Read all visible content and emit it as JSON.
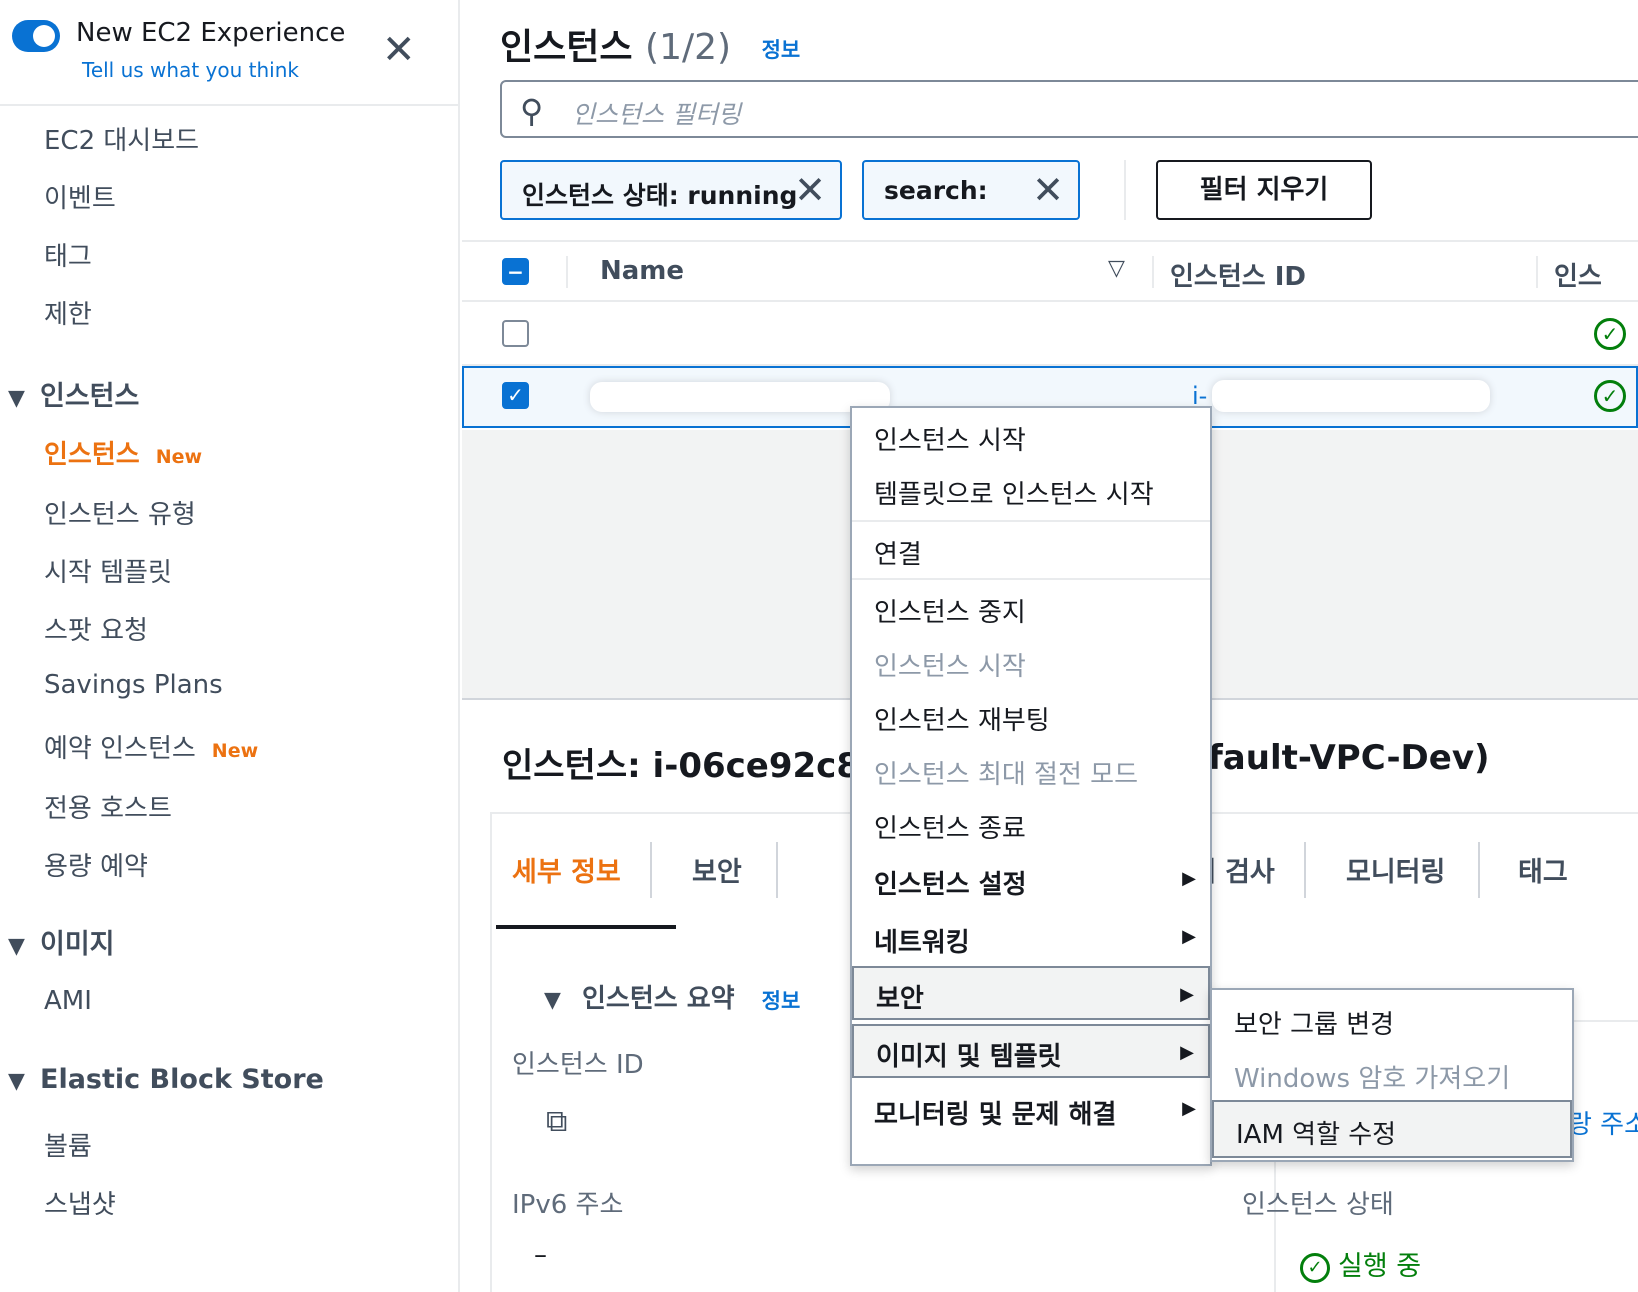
{
  "experience": {
    "title": "New EC2 Experience",
    "feedback_link": "Tell us what you think",
    "close_icon": "close-icon",
    "toggle_on": true
  },
  "sidebar": {
    "items_top": [
      {
        "label": "EC2 대시보드"
      },
      {
        "label": "이벤트"
      },
      {
        "label": "태그"
      },
      {
        "label": "제한"
      }
    ],
    "sections": [
      {
        "title": "인스턴스",
        "items": [
          {
            "label": "인스턴스",
            "badge": "New",
            "active": true
          },
          {
            "label": "인스턴스 유형"
          },
          {
            "label": "시작 템플릿"
          },
          {
            "label": "스팟 요청"
          },
          {
            "label": "Savings Plans"
          },
          {
            "label": "예약 인스턴스",
            "badge": "New"
          },
          {
            "label": "전용 호스트"
          },
          {
            "label": "용량 예약"
          }
        ]
      },
      {
        "title": "이미지",
        "items": [
          {
            "label": "AMI"
          }
        ]
      },
      {
        "title": "Elastic Block Store",
        "items": [
          {
            "label": "볼륨"
          },
          {
            "label": "스냅샷"
          }
        ]
      }
    ]
  },
  "main": {
    "title": "인스턴스",
    "count": "(1/2)",
    "info_link": "정보",
    "search_placeholder": "인스턴스 필터링",
    "tokens": [
      {
        "label": "인스턴스 상태: running"
      },
      {
        "label": "search:"
      }
    ],
    "clear_filters": "필터 지우기",
    "columns": [
      "Name",
      "인스턴스 ID",
      "인스"
    ],
    "rows": [
      {
        "selected": false,
        "status": "running"
      },
      {
        "selected": true,
        "status": "running",
        "id_prefix": "i-"
      }
    ]
  },
  "context_menu": {
    "items": [
      {
        "label": "인스턴스 시작",
        "disabled": false
      },
      {
        "label": "템플릿으로 인스턴스 시작",
        "disabled": false
      },
      {
        "label": "연결",
        "disabled": false
      },
      {
        "label": "인스턴스 중지",
        "disabled": false
      },
      {
        "label": "인스턴스 시작",
        "disabled": true
      },
      {
        "label": "인스턴스 재부팅",
        "disabled": false
      },
      {
        "label": "인스턴스 최대 절전 모드",
        "disabled": true
      },
      {
        "label": "인스턴스 종료",
        "disabled": false
      },
      {
        "label": "인스턴스 설정",
        "submenu": true
      },
      {
        "label": "네트워킹",
        "submenu": true
      },
      {
        "label": "보안",
        "submenu": true,
        "highlighted": true
      },
      {
        "label": "이미지 및 템플릿",
        "submenu": true,
        "highlighted": true
      },
      {
        "label": "모니터링 및 문제 해결",
        "submenu": true
      }
    ],
    "submenu": [
      {
        "label": "보안 그룹 변경",
        "disabled": false
      },
      {
        "label": "Windows 암호 가져오기",
        "disabled": true
      },
      {
        "label": "IAM 역할 수정",
        "disabled": false,
        "highlighted": true
      }
    ]
  },
  "details": {
    "title_prefix": "인스턴스: i-06ce92c89",
    "title_suffix": "fault-VPC-Dev)",
    "tabs": [
      "세부 정보",
      "보안",
      "상태 검사",
      "모니터링",
      "태그"
    ],
    "summary_title": "인스턴스 요약",
    "summary_info": "정보",
    "labels": {
      "instance_id": "인스턴스 ID",
      "ipv6": "IPv6 주소",
      "instance_state": "인스턴스 상태",
      "address_link": "랑 주소"
    },
    "ipv6_value": "–",
    "state_value": "실행 중"
  },
  "colors": {
    "accent": "#0972d3",
    "active_nav": "#ec7211",
    "success": "#037f0c"
  }
}
